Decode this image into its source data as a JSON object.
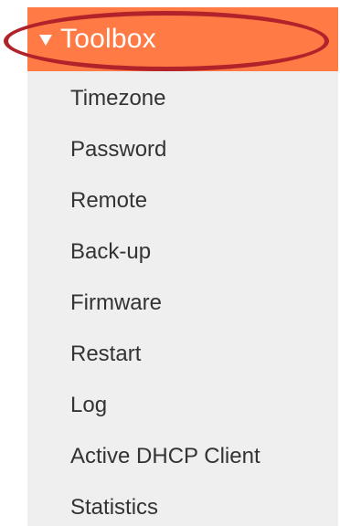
{
  "menu": {
    "header": {
      "title": "Toolbox",
      "icon": "caret-down-icon",
      "bg_color": "#ff7a45"
    },
    "highlight_color": "#b1232b",
    "items": [
      {
        "label": "Timezone"
      },
      {
        "label": "Password"
      },
      {
        "label": "Remote"
      },
      {
        "label": "Back-up"
      },
      {
        "label": "Firmware"
      },
      {
        "label": "Restart"
      },
      {
        "label": "Log"
      },
      {
        "label": "Active DHCP Client"
      },
      {
        "label": "Statistics"
      }
    ]
  }
}
